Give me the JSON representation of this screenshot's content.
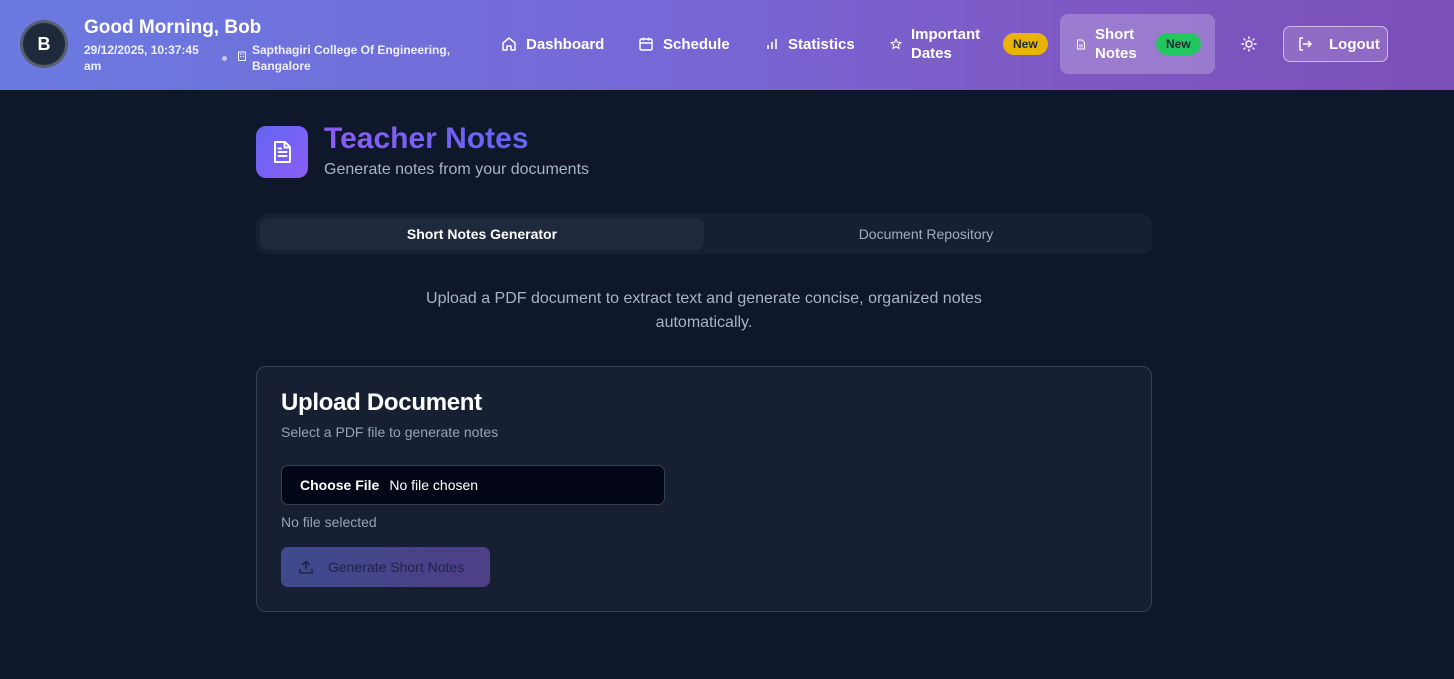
{
  "header": {
    "avatar_initial": "B",
    "greeting": "Good Morning, Bob",
    "datetime": "29/12/2025, 10:37:45 am",
    "college": "Sapthagiri College Of Engineering, Bangalore",
    "nav": {
      "dashboard": "Dashboard",
      "schedule": "Schedule",
      "statistics": "Statistics",
      "important_dates": "Important Dates",
      "important_dates_badge": "New",
      "short_notes": "Short Notes",
      "short_notes_badge": "New"
    },
    "logout": "Logout"
  },
  "page": {
    "title": "Teacher Notes",
    "subtitle": "Generate notes from your documents"
  },
  "tabs": [
    {
      "label": "Short Notes Generator",
      "active": true
    },
    {
      "label": "Document Repository",
      "active": false
    }
  ],
  "intro": "Upload a PDF document to extract text and generate concise, organized notes automatically.",
  "upload": {
    "title": "Upload Document",
    "subtitle": "Select a PDF file to generate notes",
    "choose_file": "Choose File",
    "no_file_chosen": "No file chosen",
    "status": "No file selected",
    "generate_button": "Generate Short Notes"
  },
  "colors": {
    "background": "#0f172a",
    "card": "#172033",
    "accent_start": "#6a7ae0",
    "accent_end": "#7b4fb8",
    "badge_yellow": "#eab308",
    "badge_green": "#22c55e"
  }
}
